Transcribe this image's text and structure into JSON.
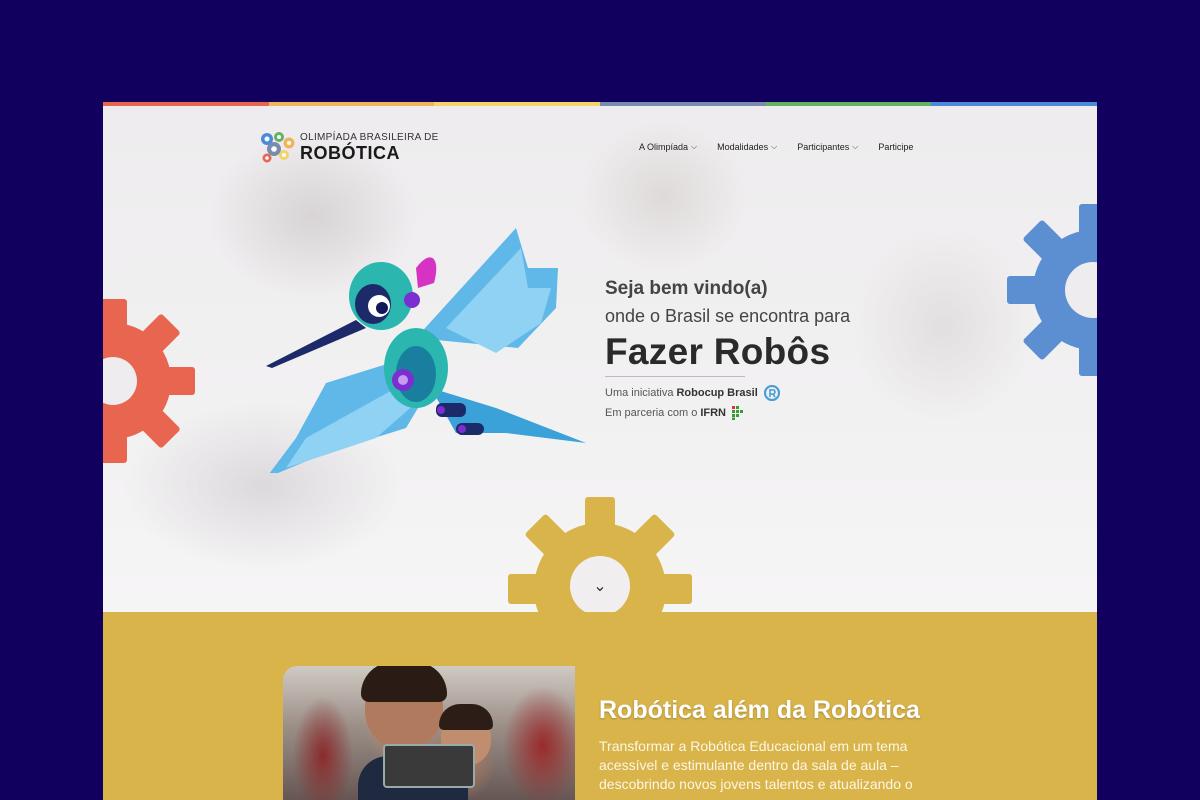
{
  "brand": {
    "small": "OLIMPÍADA BRASILEIRA DE",
    "big": "ROBÓTICA",
    "logo_icon": "gears-logo-icon"
  },
  "nav": {
    "items": [
      {
        "label": "A Olimpíada",
        "has_dropdown": true
      },
      {
        "label": "Modalidades",
        "has_dropdown": true
      },
      {
        "label": "Participantes",
        "has_dropdown": true
      },
      {
        "label": "Participe",
        "has_dropdown": false
      }
    ],
    "chevron": "⌵"
  },
  "hero": {
    "line1": "Seja bem vindo(a)",
    "line2": "onde o Brasil se encontra para",
    "headline": "Fazer Robôs",
    "initiative_prefix": "Uma iniciativa",
    "initiative_name": "Robocup Brasil",
    "partner_prefix": "Em parceria com o",
    "partner_name": "IFRN",
    "scroll_icon": "⌄"
  },
  "about": {
    "title": "Robótica além da Robótica",
    "text": "Transformar a Robótica Educacional em um tema acessível e estimulante dentro da sala de aula – descobrindo novos jovens talentos e atualizando o"
  },
  "colors": {
    "backdrop": "#12005f",
    "section_yellow": "#d9b44a",
    "gear_red": "#e8654f",
    "gear_blue": "#5b8fd2",
    "gear_yellow": "#d9b44a",
    "stripe": [
      "#e8654f",
      "#f0b45a",
      "#f3d36a",
      "#7b8bb0",
      "#63b264",
      "#4a8ad8"
    ]
  }
}
